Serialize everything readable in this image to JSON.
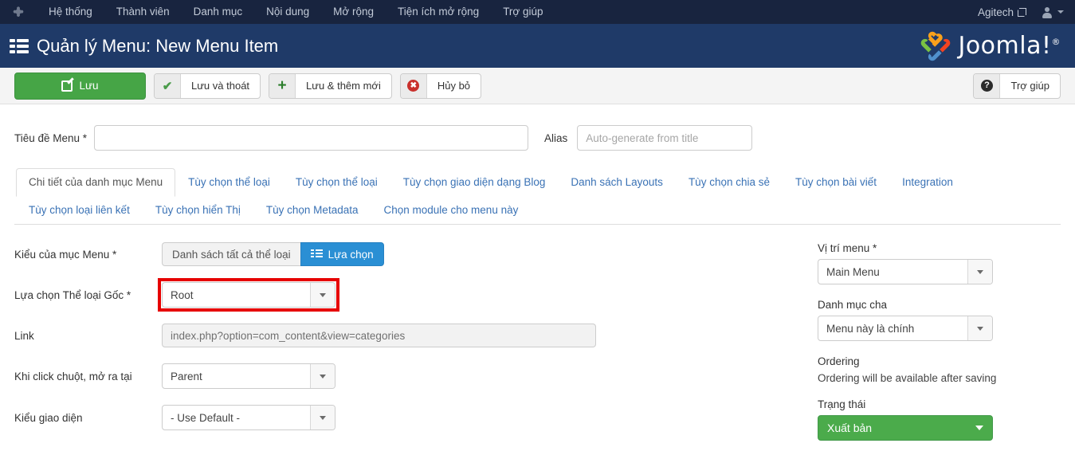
{
  "topbar": {
    "logo_icon": "joomla-logo-icon",
    "menu": [
      {
        "label": "Hệ thống"
      },
      {
        "label": "Thành viên"
      },
      {
        "label": "Danh mục"
      },
      {
        "label": "Nội dung"
      },
      {
        "label": "Mở rộng"
      },
      {
        "label": "Tiện ích mở rộng"
      },
      {
        "label": "Trợ giúp"
      }
    ],
    "site_name": "Agitech",
    "site_link_icon": "external-link-icon",
    "user_icon": "user-avatar-icon",
    "user_caret_icon": "caret-down-icon"
  },
  "header": {
    "icon": "menu-grid-icon",
    "title": "Quản lý Menu: New Menu Item",
    "brand": "Joomla!",
    "brand_reg": "®",
    "brand_icon": "joomla-brand-icon",
    "bg_color": "#1f3a68"
  },
  "toolbar": {
    "save": {
      "label": "Lưu",
      "icon": "save-pencil-icon",
      "color": "#46a546"
    },
    "save_close": {
      "label": "Lưu và thoát",
      "icon": "check-icon"
    },
    "save_new": {
      "label": "Lưu & thêm mới",
      "icon": "plus-icon"
    },
    "cancel": {
      "label": "Hủy bỏ",
      "icon": "cancel-circle-icon"
    },
    "help": {
      "label": "Trợ giúp",
      "icon": "question-circle-icon"
    }
  },
  "form": {
    "menu_title_label": "Tiêu đề Menu *",
    "menu_title_value": "",
    "menu_title_placeholder": "",
    "alias_label": "Alias",
    "alias_value": "",
    "alias_placeholder": "Auto-generate from title"
  },
  "tabs": [
    {
      "label": "Chi tiết của danh mục Menu",
      "active": true
    },
    {
      "label": "Tùy chọn thể loại",
      "active": false
    },
    {
      "label": "Tùy chọn thể loại",
      "active": false
    },
    {
      "label": "Tùy chọn giao diện dạng Blog",
      "active": false
    },
    {
      "label": "Danh sách Layouts",
      "active": false
    },
    {
      "label": "Tùy chọn chia sẻ",
      "active": false
    },
    {
      "label": "Tùy chọn bài viết",
      "active": false
    },
    {
      "label": "Integration",
      "active": false
    },
    {
      "label": "Tùy chọn loại liên kết",
      "active": false
    },
    {
      "label": "Tùy chọn hiển Thị",
      "active": false
    },
    {
      "label": "Tùy chọn Metadata",
      "active": false
    },
    {
      "label": "Chọn module cho menu này",
      "active": false
    }
  ],
  "details": {
    "menu_item_type": {
      "label": "Kiểu của mục Menu *",
      "value": "Danh sách tất cả thể loại",
      "button_label": "Lựa chọn",
      "button_icon": "list-grid-icon",
      "button_color": "#2a8fd4"
    },
    "root_category": {
      "label": "Lựa chọn Thể loại Gốc *",
      "value": "Root",
      "highlighted": true,
      "highlight_color": "#e60000"
    },
    "link": {
      "label": "Link",
      "value": "index.php?option=com_content&view=categories"
    },
    "target_window": {
      "label": "Khi click chuột, mở ra tại",
      "value": "Parent"
    },
    "template_style": {
      "label": "Kiểu giao diện",
      "value": "- Use Default -"
    }
  },
  "sidebar": {
    "menu_location": {
      "label": "Vị trí menu *",
      "value": "Main Menu"
    },
    "parent_item": {
      "label": "Danh mục cha",
      "value": "Menu này là chính"
    },
    "ordering": {
      "label": "Ordering",
      "note": "Ordering will be available after saving"
    },
    "status": {
      "label": "Trạng thái",
      "value": "Xuất bản",
      "color": "#4bab4b"
    }
  }
}
